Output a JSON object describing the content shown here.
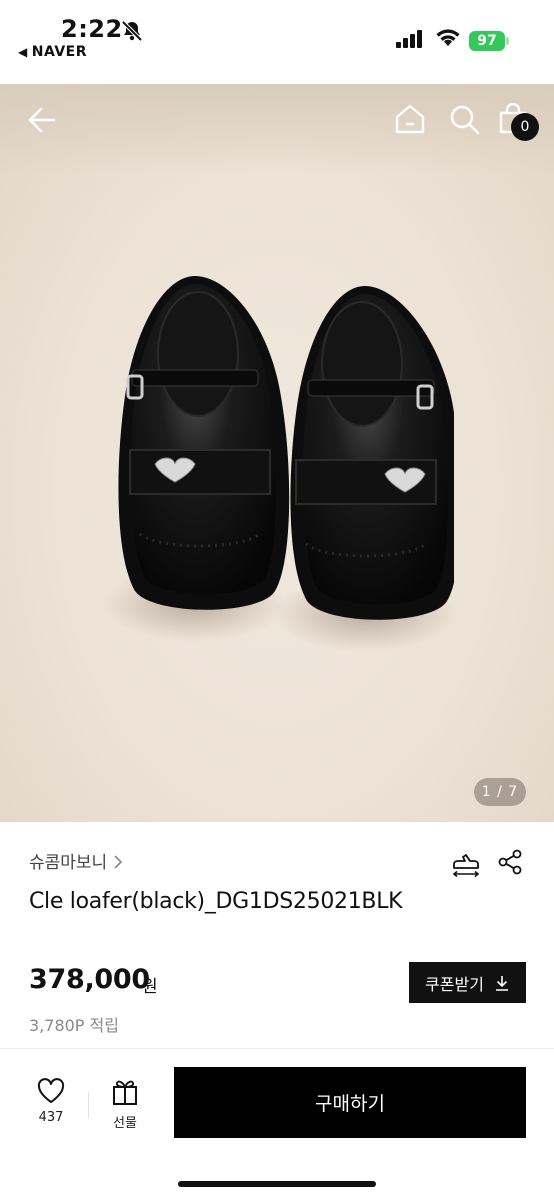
{
  "status_bar": {
    "time": "2:22",
    "app": "NAVER",
    "battery": "97"
  },
  "header": {
    "cart_count": "0"
  },
  "gallery": {
    "page_indicator": "1 / 7"
  },
  "product": {
    "brand": "슈콤마보니",
    "title": "Cle loafer(black)_DG1DS25021BLK",
    "price": "378,000",
    "price_unit": "원",
    "points": "3,780P 적립",
    "coupon_label": "쿠폰받기"
  },
  "bottom_bar": {
    "like_count": "437",
    "gift_label": "선물",
    "buy_label": "구매하기"
  },
  "colors": {
    "battery": "#34c759",
    "hero_background": "#ece2d6",
    "primary_button": "#000000"
  },
  "icons": [
    "bell-muted-icon",
    "signal-icon",
    "wifi-icon",
    "back-arrow-icon",
    "home-icon",
    "search-icon",
    "shopping-bag-icon",
    "chevron-right-icon",
    "size-guide-icon",
    "share-icon",
    "download-icon",
    "heart-icon",
    "gift-icon"
  ]
}
